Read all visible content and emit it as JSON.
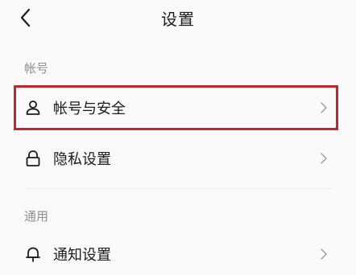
{
  "nav": {
    "title": "设置",
    "back_icon": "chevron-left-icon"
  },
  "sections": [
    {
      "header": "帐号",
      "items": [
        {
          "label": "帐号与安全",
          "icon": "person-icon",
          "highlighted": true
        },
        {
          "label": "隐私设置",
          "icon": "lock-icon",
          "highlighted": false
        }
      ]
    },
    {
      "header": "通用",
      "items": [
        {
          "label": "通知设置",
          "icon": "bell-icon",
          "highlighted": false
        }
      ]
    }
  ],
  "colors": {
    "highlight_border": "#c0272d",
    "section_header": "#8e8e93",
    "background": "#fafafa"
  }
}
